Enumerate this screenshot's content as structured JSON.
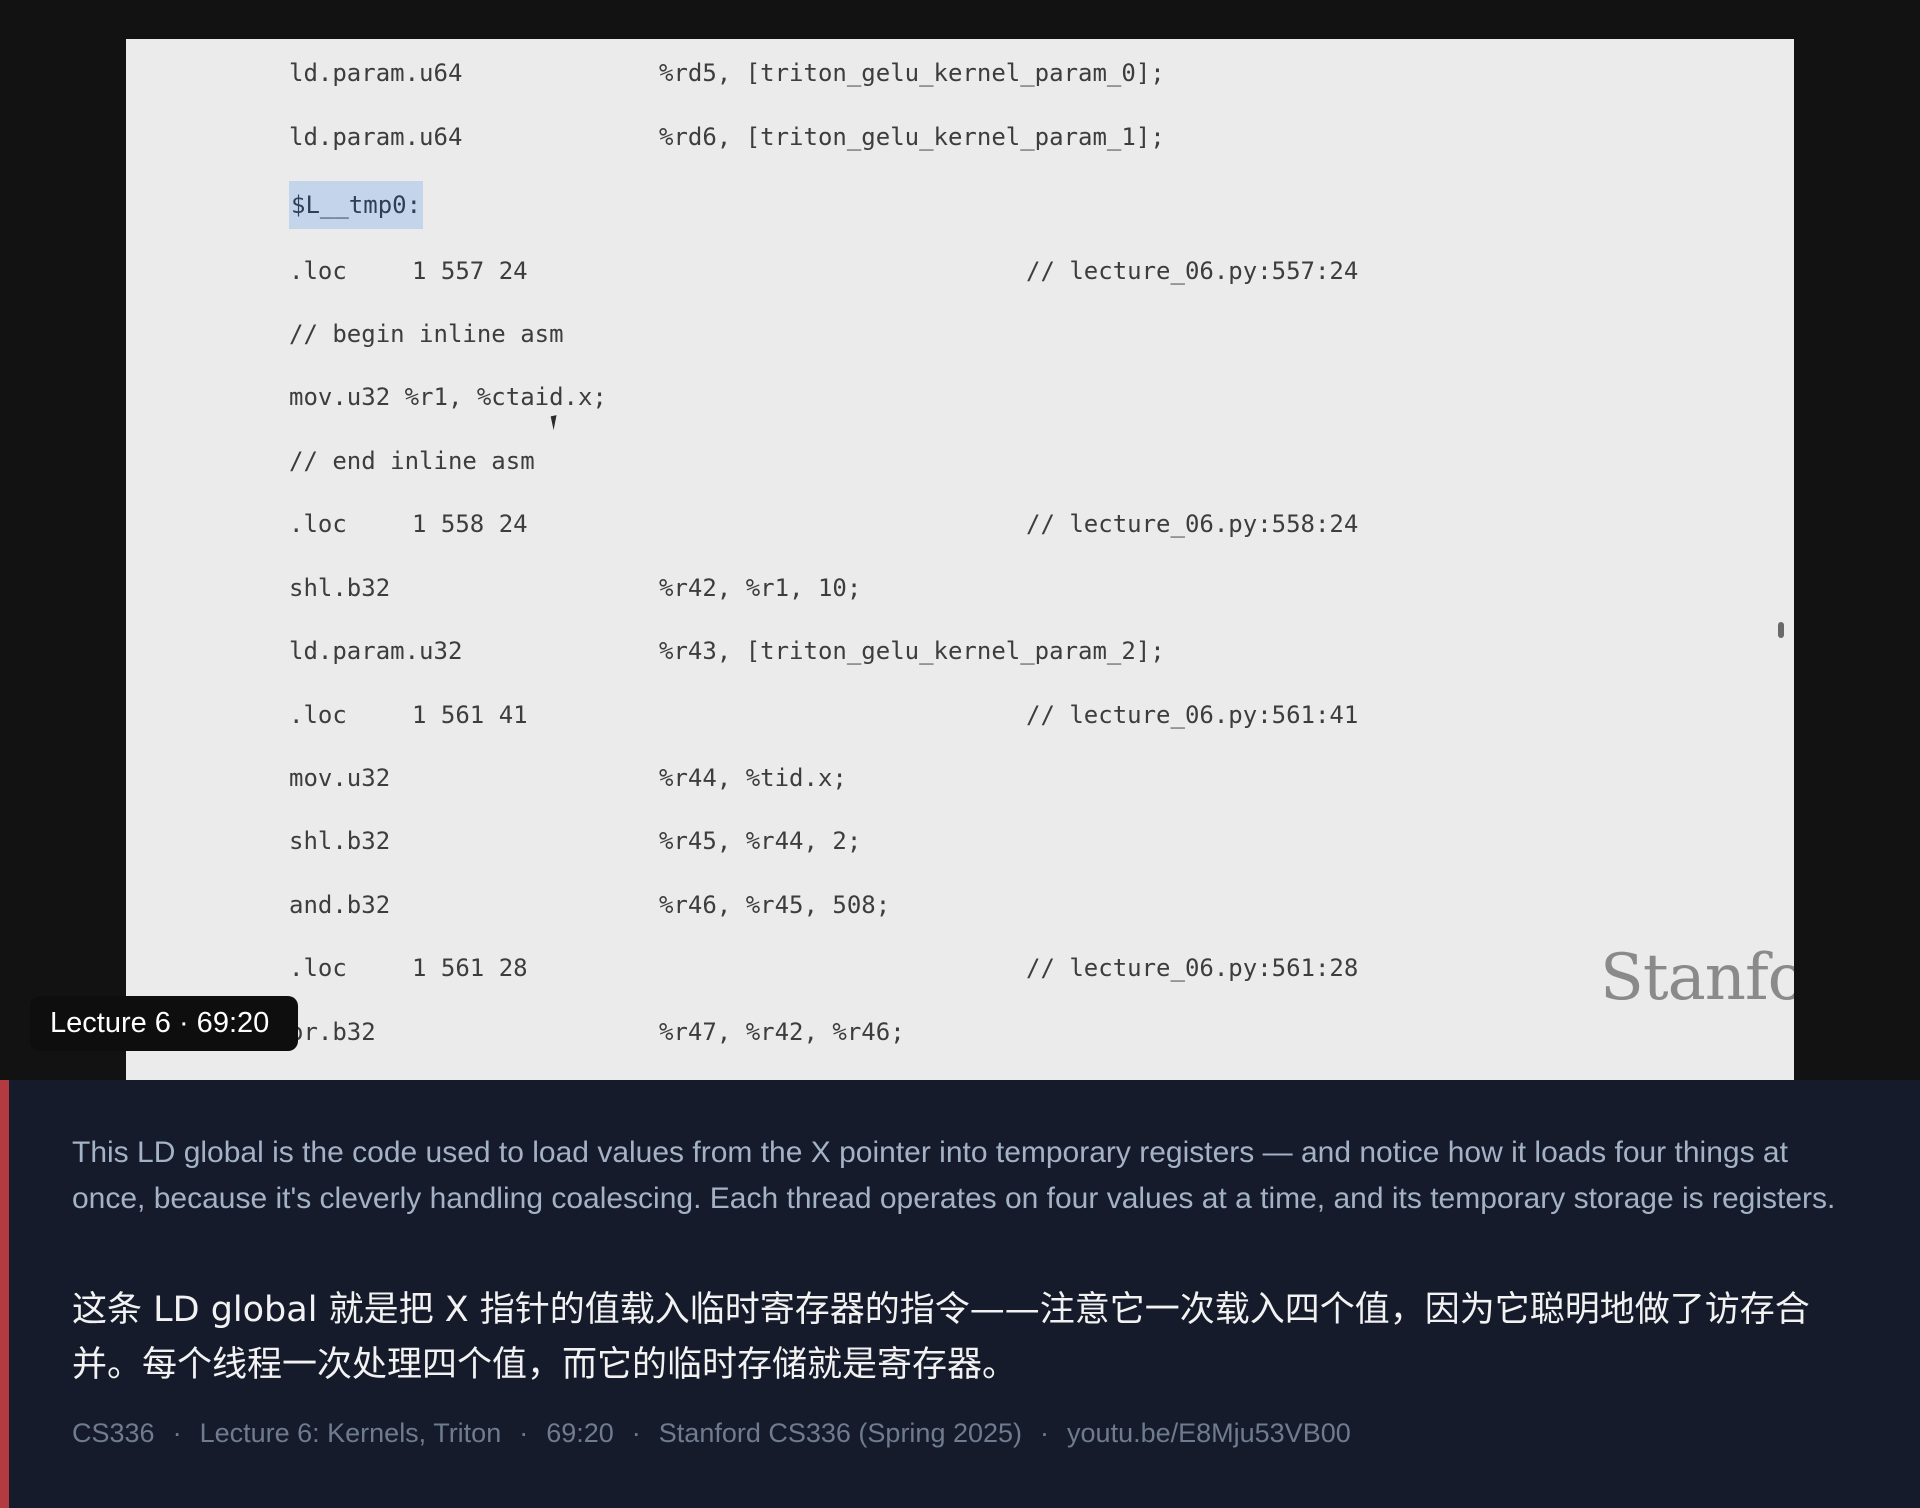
{
  "slide": {
    "code_lines": [
      {
        "op": "ld.param.u64",
        "args": "%rd5, [triton_gelu_kernel_param_0];"
      },
      {
        "op": "ld.param.u64",
        "args": "%rd6, [triton_gelu_kernel_param_1];"
      },
      {
        "label": "$L__tmp0:"
      },
      {
        "loc": ".loc",
        "pos": "1 557 24",
        "comment": "// lecture_06.py:557:24"
      },
      {
        "text": "// begin inline asm"
      },
      {
        "text": "mov.u32 %r1, %ctaid.x;"
      },
      {
        "text": "// end inline asm"
      },
      {
        "loc": ".loc",
        "pos": "1 558 24",
        "comment": "// lecture_06.py:558:24"
      },
      {
        "op": "shl.b32",
        "args": "%r42, %r1, 10;"
      },
      {
        "op": "ld.param.u32",
        "args": "%r43, [triton_gelu_kernel_param_2];"
      },
      {
        "loc": ".loc",
        "pos": "1 561 41",
        "comment": "// lecture_06.py:561:41"
      },
      {
        "op": "mov.u32",
        "args": "%r44, %tid.x;"
      },
      {
        "op": "shl.b32",
        "args": "%r45, %r44, 2;"
      },
      {
        "op": "and.b32",
        "args": "%r46, %r45, 508;"
      },
      {
        "loc": ".loc",
        "pos": "1 561 28",
        "comment": "// lecture_06.py:561:28"
      },
      {
        "op": "or.b32",
        "args": "%r47, %r42, %r46;"
      }
    ],
    "logo_text": "Stanford"
  },
  "overlay": {
    "timestamp_badge": "Lecture 6 · 69:20"
  },
  "caption": {
    "english": "This LD global is the code used to load values from the X pointer into temporary registers — and notice how it loads four things at once, because it's cleverly handling coalescing. Each thread operates on four values at a time, and its temporary storage is registers.",
    "chinese": "这条 LD global 就是把 X 指针的值载入临时寄存器的指令——注意它一次载入四个值，因为它聪明地做了访存合并。每个线程一次处理四个值，而它的临时存储就是寄存器。",
    "meta": {
      "course": "CS336",
      "lecture": "Lecture 6: Kernels, Triton",
      "time": "69:20",
      "series": "Stanford CS336 (Spring 2025)",
      "link": "youtu.be/E8Mju53VB00"
    }
  },
  "colors": {
    "slide_background": "#ebebeb",
    "label_highlight": "#c4d4ea",
    "caption_background": "#151b2a",
    "accent_bar": "#b23a40",
    "english_caption": "#a4b2c6",
    "chinese_caption": "#f2f2f2"
  }
}
